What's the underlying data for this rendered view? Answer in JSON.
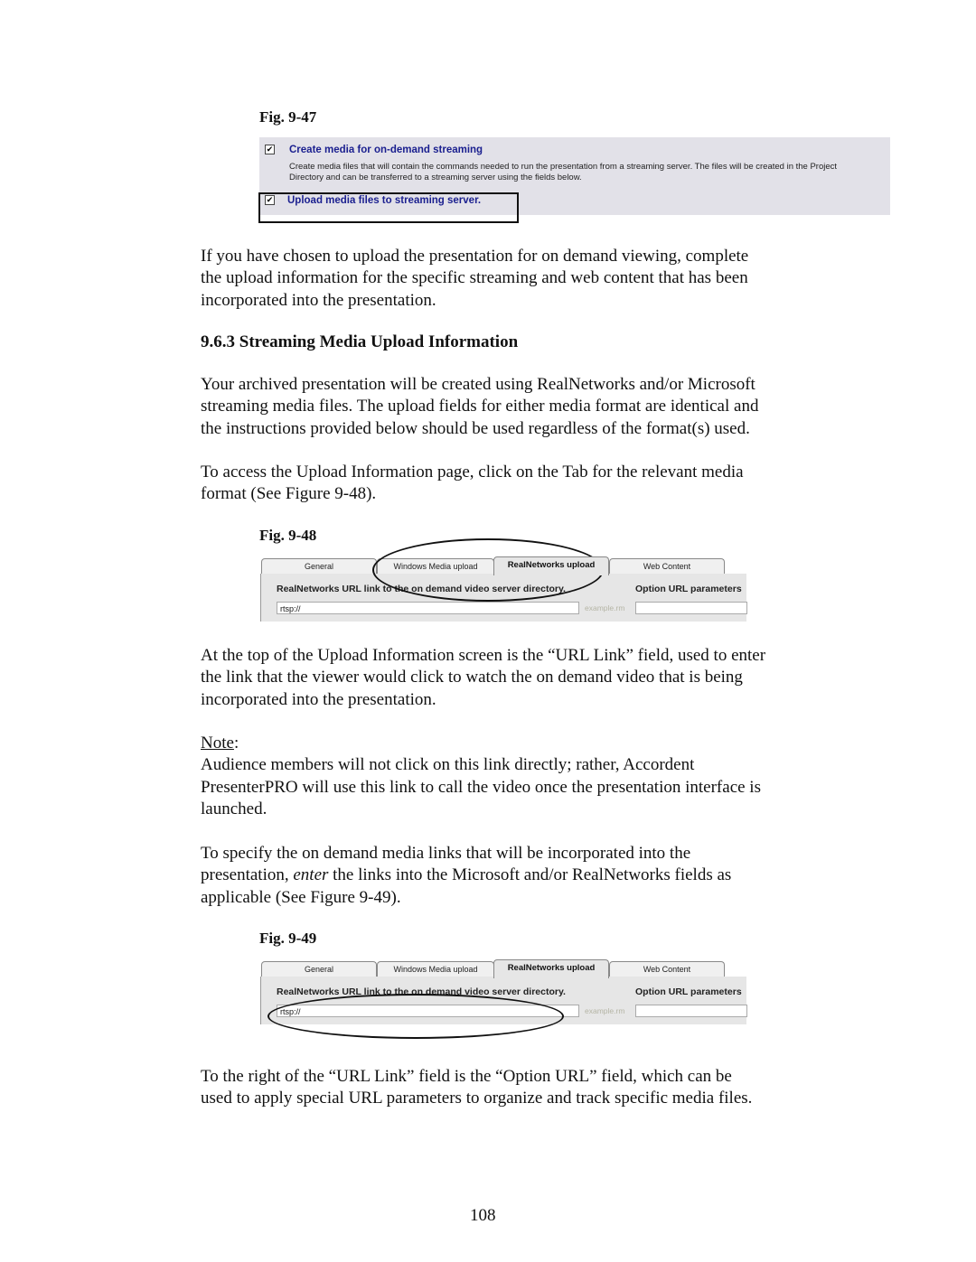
{
  "fig47": {
    "caption": "Fig. 9-47",
    "option1": {
      "checked": true,
      "check_glyph": "✔",
      "title": "Create media for on-demand streaming",
      "desc_line1": "Create media files that will contain the commands needed to run the presentation from a streaming server. The files will be created in the Project",
      "desc_line2": "Directory and can be transferred to a streaming server using the fields below."
    },
    "option2": {
      "checked": true,
      "check_glyph": "✔",
      "title": "Upload media files to streaming server."
    }
  },
  "para1": [
    "If you have chosen to upload the presentation for on demand viewing, complete",
    "the upload information for the specific streaming and web content that has been",
    "incorporated into the presentation."
  ],
  "section_heading": "9.6.3  Streaming Media Upload Information",
  "para2": [
    "Your archived presentation will be created using RealNetworks and/or Microsoft",
    "streaming media files.  The upload fields for either media format are identical and",
    "the instructions provided below should be used regardless of the format(s) used."
  ],
  "para3": [
    "To access the Upload Information page, click on the Tab for the relevant media",
    "format (See Figure 9-48)."
  ],
  "fig48": {
    "caption": "Fig. 9-48"
  },
  "fig49": {
    "caption": "Fig. 9-49"
  },
  "tabs": [
    "General",
    "Windows Media upload",
    "RealNetworks upload",
    "Web Content"
  ],
  "active_tab": "RealNetworks upload",
  "url_label": "RealNetworks URL link to the on demand video server directory.",
  "url_value": "rtsp://",
  "example_text": "example.rm",
  "option_label": "Option URL parameters",
  "option_value": "",
  "para4": [
    "At the top of the Upload Information screen is the “URL Link” field, used to enter",
    "the link that the viewer would click to watch the on demand video that is being",
    "incorporated into the presentation."
  ],
  "note_label": "Note",
  "note_colon": ":",
  "note_text": [
    "Audience members will not click on this link directly; rather, Accordent",
    "PresenterPRO will use this link to call the video once the presentation interface is",
    "launched."
  ],
  "para5": {
    "line1": "To specify the on demand media links that will be incorporated into the",
    "line2_pre": "presentation, ",
    "line2_em": "enter",
    "line2_post": " the links into the Microsoft and/or RealNetworks fields as",
    "line3": "applicable (See Figure 9-49)."
  },
  "para6": [
    "To the right of the “URL Link” field is the “Option URL” field, which can be",
    "used to apply special URL parameters to organize and track specific media files."
  ],
  "page_number": "108"
}
